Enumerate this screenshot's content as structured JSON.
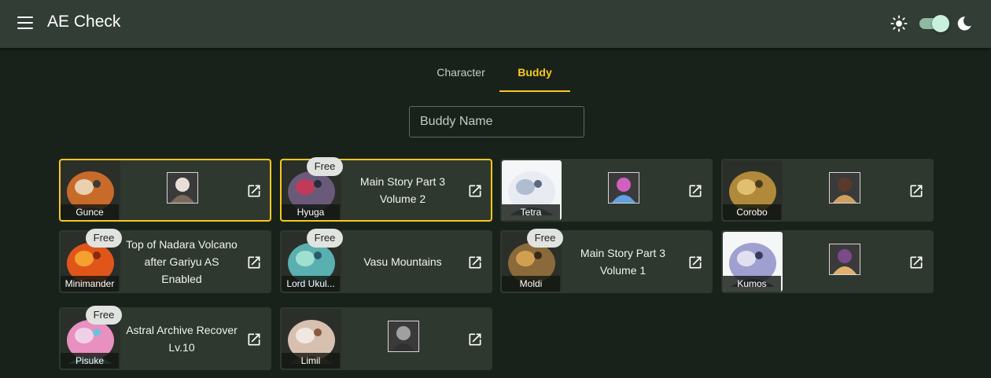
{
  "appbar": {
    "title": "AE Check"
  },
  "tabs": {
    "character": "Character",
    "buddy": "Buddy"
  },
  "search": {
    "placeholder": "Buddy Name",
    "value": ""
  },
  "badge": {
    "free": "Free"
  },
  "colors": {
    "accent": "#f7c81d",
    "background": "#19221a",
    "appbar": "#323d35",
    "card": "#2f382f"
  },
  "buddies": [
    {
      "name": "Gunce",
      "selected": true,
      "free": false,
      "location": "",
      "char_portrait": true
    },
    {
      "name": "Hyuga",
      "selected": true,
      "free": true,
      "location": "Main Story Part 3 Volume 2",
      "char_portrait": false
    },
    {
      "name": "Tetra",
      "selected": false,
      "free": false,
      "location": "",
      "char_portrait": true
    },
    {
      "name": "Corobo",
      "selected": false,
      "free": false,
      "location": "",
      "char_portrait": true
    },
    {
      "name": "Minimander",
      "selected": false,
      "free": true,
      "location": "Top of Nadara Volcano after Gariyu AS Enabled",
      "char_portrait": false
    },
    {
      "name": "Lord Ukul...",
      "selected": false,
      "free": true,
      "location": "Vasu Mountains",
      "char_portrait": false
    },
    {
      "name": "Moldi",
      "selected": false,
      "free": true,
      "location": "Main Story Part 3 Volume 1",
      "char_portrait": false
    },
    {
      "name": "Kumos",
      "selected": false,
      "free": false,
      "location": "",
      "char_portrait": true
    },
    {
      "name": "Pisuke",
      "selected": false,
      "free": true,
      "location": "Astral Archive Recover Lv.10",
      "char_portrait": false
    },
    {
      "name": "Limil",
      "selected": false,
      "free": false,
      "location": "",
      "char_portrait": true
    }
  ],
  "icons": {
    "menu": "menu-icon",
    "light": "sun-icon",
    "dark": "moon-icon",
    "open": "open-in-new-icon"
  }
}
